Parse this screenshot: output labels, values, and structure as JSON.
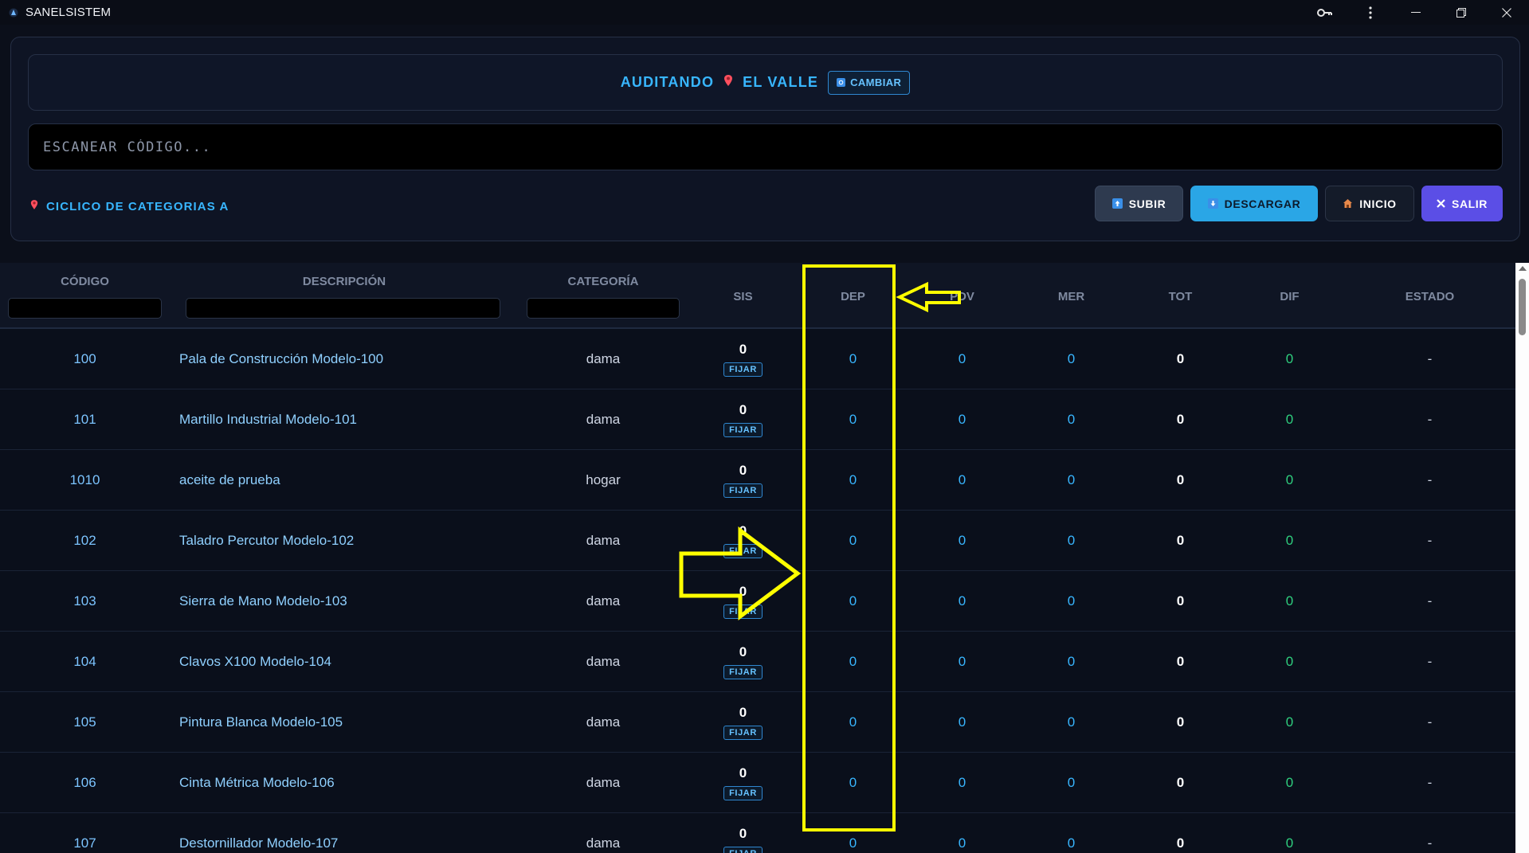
{
  "window": {
    "title": "SANELSISTEM",
    "controls": [
      "key-icon",
      "more-vertical-icon",
      "minimize-icon",
      "restore-icon",
      "close-icon"
    ]
  },
  "header": {
    "auditing_label": "AUDITANDO",
    "location": "EL VALLE",
    "change_label": "CAMBIAR",
    "scan_placeholder": "ESCANEAR CÓDIGO...",
    "cyclic_label": "CICLICO DE CATEGORIAS A"
  },
  "actions": {
    "subir": "SUBIR",
    "descargar": "DESCARGAR",
    "inicio": "INICIO",
    "salir": "SALIR"
  },
  "table": {
    "columns": {
      "codigo": "CÓDIGO",
      "descripcion": "DESCRIPCIÓN",
      "categoria": "CATEGORÍA",
      "sis": "SIS",
      "dep": "DEP",
      "pdv": "PDV",
      "mer": "MER",
      "tot": "TOT",
      "dif": "DIF",
      "estado": "ESTADO"
    },
    "fix_label": "FIJAR",
    "rows": [
      {
        "codigo": "100",
        "descripcion": "Pala de Construcción Modelo-100",
        "categoria": "dama",
        "sis": "0",
        "dep": "0",
        "pdv": "0",
        "mer": "0",
        "tot": "0",
        "dif": "0",
        "estado": "-"
      },
      {
        "codigo": "101",
        "descripcion": "Martillo Industrial Modelo-101",
        "categoria": "dama",
        "sis": "0",
        "dep": "0",
        "pdv": "0",
        "mer": "0",
        "tot": "0",
        "dif": "0",
        "estado": "-"
      },
      {
        "codigo": "1010",
        "descripcion": "aceite de prueba",
        "categoria": "hogar",
        "sis": "0",
        "dep": "0",
        "pdv": "0",
        "mer": "0",
        "tot": "0",
        "dif": "0",
        "estado": "-"
      },
      {
        "codigo": "102",
        "descripcion": "Taladro Percutor Modelo-102",
        "categoria": "dama",
        "sis": "0",
        "dep": "0",
        "pdv": "0",
        "mer": "0",
        "tot": "0",
        "dif": "0",
        "estado": "-"
      },
      {
        "codigo": "103",
        "descripcion": "Sierra de Mano Modelo-103",
        "categoria": "dama",
        "sis": "0",
        "dep": "0",
        "pdv": "0",
        "mer": "0",
        "tot": "0",
        "dif": "0",
        "estado": "-"
      },
      {
        "codigo": "104",
        "descripcion": "Clavos X100 Modelo-104",
        "categoria": "dama",
        "sis": "0",
        "dep": "0",
        "pdv": "0",
        "mer": "0",
        "tot": "0",
        "dif": "0",
        "estado": "-"
      },
      {
        "codigo": "105",
        "descripcion": "Pintura Blanca Modelo-105",
        "categoria": "dama",
        "sis": "0",
        "dep": "0",
        "pdv": "0",
        "mer": "0",
        "tot": "0",
        "dif": "0",
        "estado": "-"
      },
      {
        "codigo": "106",
        "descripcion": "Cinta Métrica Modelo-106",
        "categoria": "dama",
        "sis": "0",
        "dep": "0",
        "pdv": "0",
        "mer": "0",
        "tot": "0",
        "dif": "0",
        "estado": "-"
      },
      {
        "codigo": "107",
        "descripcion": "Destornillador Modelo-107",
        "categoria": "dama",
        "sis": "0",
        "dep": "0",
        "pdv": "0",
        "mer": "0",
        "tot": "0",
        "dif": "0",
        "estado": "-"
      }
    ]
  },
  "colors": {
    "accent": "#38b6ff",
    "positive": "#2fd07f",
    "annotation": "#ffff00",
    "salir": "#5b4ee6",
    "descargar": "#2aa6e6"
  }
}
